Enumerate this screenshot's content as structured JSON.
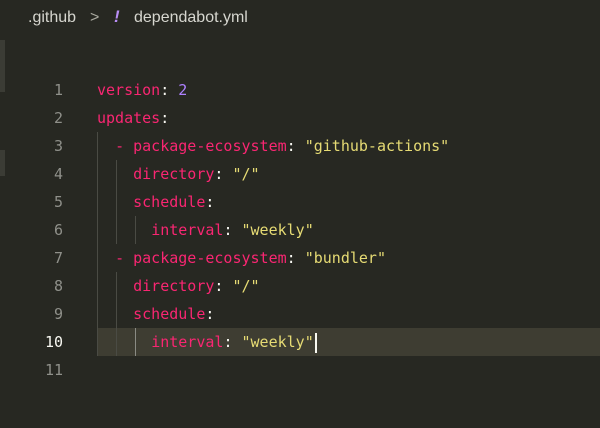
{
  "breadcrumb": {
    "folder": ".github",
    "separator": ">",
    "file_icon": "!",
    "file": "dependabot.yml"
  },
  "editor": {
    "current_line": 10,
    "lines": [
      {
        "num": "1",
        "key": "version",
        "colon": ":",
        "value": "2"
      },
      {
        "num": "2",
        "key": "updates",
        "colon": ":"
      },
      {
        "num": "3",
        "dash": "-",
        "key": "package-ecosystem",
        "colon": ":",
        "value": "\"github-actions\""
      },
      {
        "num": "4",
        "key": "directory",
        "colon": ":",
        "value": "\"/\""
      },
      {
        "num": "5",
        "key": "schedule",
        "colon": ":"
      },
      {
        "num": "6",
        "key": "interval",
        "colon": ":",
        "value": "\"weekly\""
      },
      {
        "num": "7",
        "dash": "-",
        "key": "package-ecosystem",
        "colon": ":",
        "value": "\"bundler\""
      },
      {
        "num": "8",
        "key": "directory",
        "colon": ":",
        "value": "\"/\""
      },
      {
        "num": "9",
        "key": "schedule",
        "colon": ":"
      },
      {
        "num": "10",
        "key": "interval",
        "colon": ":",
        "value": "\"weekly\""
      },
      {
        "num": "11"
      }
    ]
  },
  "colors": {
    "background": "#272822",
    "key": "#f92672",
    "string": "#e6db74",
    "number": "#ae81ff"
  }
}
